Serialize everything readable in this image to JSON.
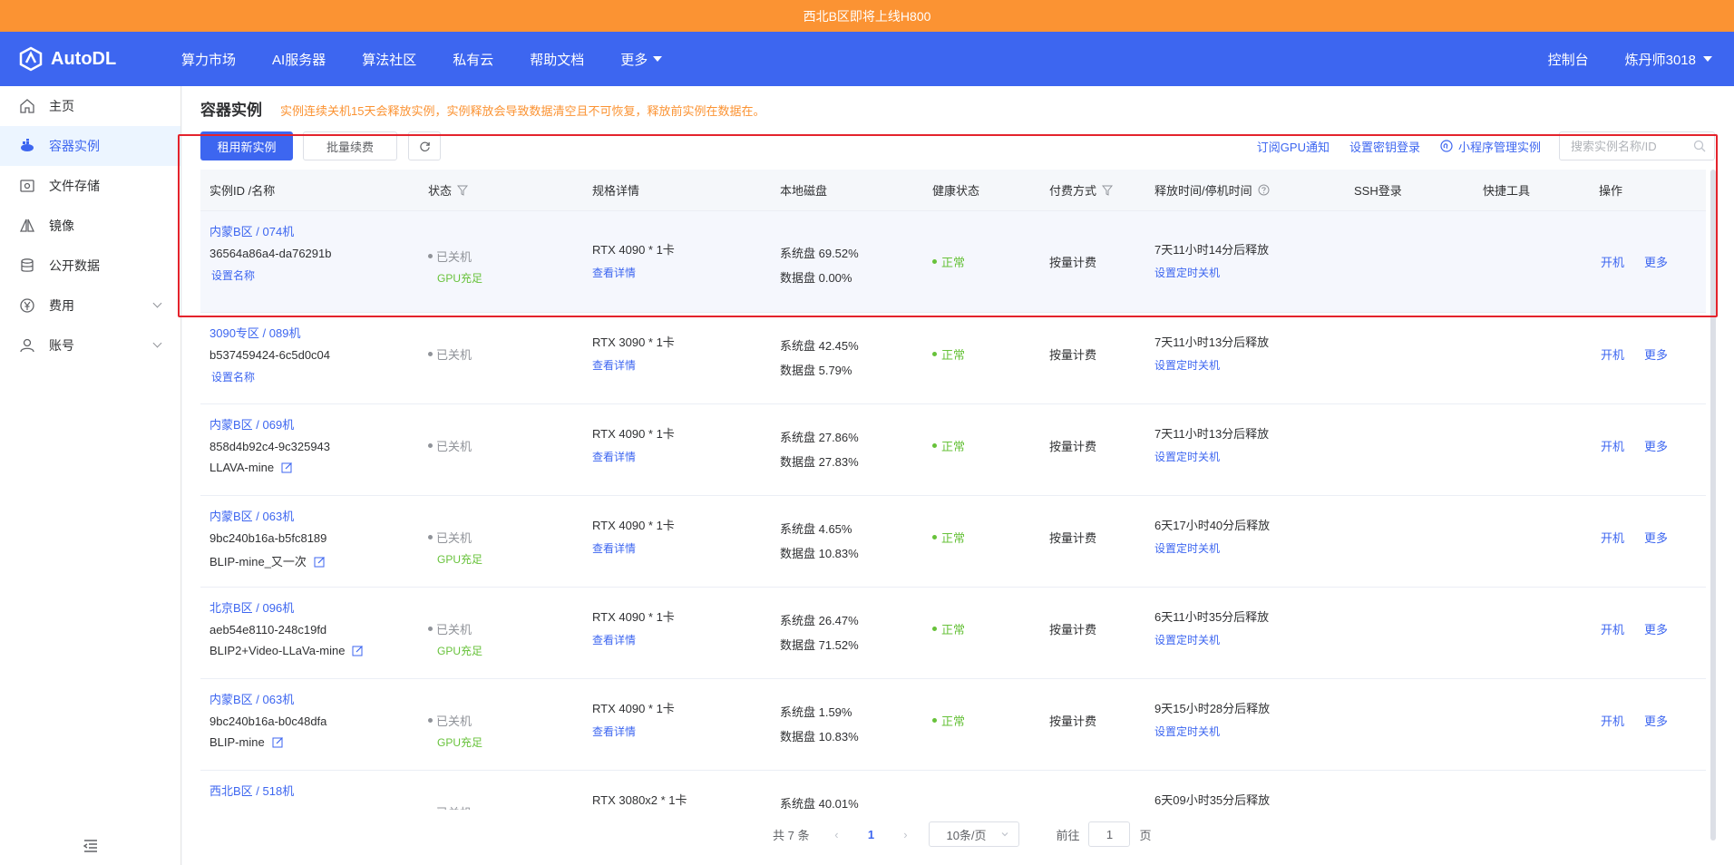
{
  "banner": {
    "text": "西北B区即将上线H800"
  },
  "nav": {
    "brand": "AutoDL",
    "links": [
      "算力市场",
      "AI服务器",
      "算法社区",
      "私有云",
      "帮助文档",
      "更多"
    ],
    "console": "控制台",
    "user": "炼丹师3018"
  },
  "sidebar": {
    "items": [
      {
        "label": "主页",
        "icon": "home-icon"
      },
      {
        "label": "容器实例",
        "icon": "container-icon",
        "active": true
      },
      {
        "label": "文件存储",
        "icon": "storage-icon"
      },
      {
        "label": "镜像",
        "icon": "mirror-icon"
      },
      {
        "label": "公开数据",
        "icon": "database-icon"
      },
      {
        "label": "费用",
        "icon": "yen-icon",
        "expandable": true
      },
      {
        "label": "账号",
        "icon": "user-icon",
        "expandable": true
      }
    ]
  },
  "page": {
    "title": "容器实例",
    "warning": "实例连续关机15天会释放实例，实例释放会导致数据清空且不可恢复，释放前实例在数据在。"
  },
  "toolbar": {
    "new_instance": "租用新实例",
    "batch_renew": "批量续费",
    "subscribe_gpu": "订阅GPU通知",
    "set_key": "设置密钥登录",
    "miniprogram": "小程序管理实例",
    "search_placeholder": "搜索实例名称/ID"
  },
  "table": {
    "headers": [
      "实例ID /名称",
      "状态",
      "规格详情",
      "本地磁盘",
      "健康状态",
      "付费方式",
      "释放时间/停机时间",
      "SSH登录",
      "快捷工具",
      "操作"
    ],
    "rows": [
      {
        "region": "内蒙B区 / 074机",
        "id": "36564a86a4-da76291b",
        "name": "设置名称",
        "name_set": false,
        "status": "已关机",
        "gpu": "GPU充足",
        "spec": "RTX 4090 * 1卡",
        "detail": "查看详情",
        "sys_disk": "系统盘 69.52%",
        "data_disk": "数据盘 0.00%",
        "health": "正常",
        "pay": "按量计费",
        "release": "7天11小时14分后释放",
        "timer": "设置定时关机",
        "op1": "开机",
        "op2": "更多"
      },
      {
        "region": "3090专区 / 089机",
        "id": "b537459424-6c5d0c04",
        "name": "设置名称",
        "name_set": false,
        "status": "已关机",
        "gpu": "",
        "spec": "RTX 3090 * 1卡",
        "detail": "查看详情",
        "sys_disk": "系统盘 42.45%",
        "data_disk": "数据盘 5.79%",
        "health": "正常",
        "pay": "按量计费",
        "release": "7天11小时13分后释放",
        "timer": "设置定时关机",
        "op1": "开机",
        "op2": "更多"
      },
      {
        "region": "内蒙B区 / 069机",
        "id": "858d4b92c4-9c325943",
        "name": "LLAVA-mine",
        "name_set": true,
        "status": "已关机",
        "gpu": "",
        "spec": "RTX 4090 * 1卡",
        "detail": "查看详情",
        "sys_disk": "系统盘 27.86%",
        "data_disk": "数据盘 27.83%",
        "health": "正常",
        "pay": "按量计费",
        "release": "7天11小时13分后释放",
        "timer": "设置定时关机",
        "op1": "开机",
        "op2": "更多"
      },
      {
        "region": "内蒙B区 / 063机",
        "id": "9bc240b16a-b5fc8189",
        "name": "BLIP-mine_又一次",
        "name_set": true,
        "status": "已关机",
        "gpu": "GPU充足",
        "spec": "RTX 4090 * 1卡",
        "detail": "查看详情",
        "sys_disk": "系统盘 4.65%",
        "data_disk": "数据盘 10.83%",
        "health": "正常",
        "pay": "按量计费",
        "release": "6天17小时40分后释放",
        "timer": "设置定时关机",
        "op1": "开机",
        "op2": "更多"
      },
      {
        "region": "北京B区 / 096机",
        "id": "aeb54e8110-248c19fd",
        "name": "BLIP2+Video-LLaVa-mine",
        "name_set": true,
        "status": "已关机",
        "gpu": "GPU充足",
        "spec": "RTX 4090 * 1卡",
        "detail": "查看详情",
        "sys_disk": "系统盘 26.47%",
        "data_disk": "数据盘 71.52%",
        "health": "正常",
        "pay": "按量计费",
        "release": "6天11小时35分后释放",
        "timer": "设置定时关机",
        "op1": "开机",
        "op2": "更多"
      },
      {
        "region": "内蒙B区 / 063机",
        "id": "9bc240b16a-b0c48dfa",
        "name": "BLIP-mine",
        "name_set": true,
        "status": "已关机",
        "gpu": "GPU充足",
        "spec": "RTX 4090 * 1卡",
        "detail": "查看详情",
        "sys_disk": "系统盘 1.59%",
        "data_disk": "数据盘 10.83%",
        "health": "正常",
        "pay": "按量计费",
        "release": "9天15小时28分后释放",
        "timer": "设置定时关机",
        "op1": "开机",
        "op2": "更多"
      },
      {
        "region": "西北B区 / 518机",
        "id": "",
        "name": "",
        "name_set": false,
        "status": "已关机",
        "gpu": "",
        "spec": "RTX 3080x2 * 1卡",
        "detail": "",
        "sys_disk": "系统盘 40.01%",
        "data_disk": "",
        "health": "",
        "pay": "",
        "release": "6天09小时35分后释放",
        "timer": "",
        "op1": "",
        "op2": ""
      }
    ]
  },
  "pager": {
    "total": "共 7 条",
    "current": "1",
    "size": "10条/页",
    "goto": "前往",
    "goto_value": "1",
    "page_unit": "页"
  }
}
